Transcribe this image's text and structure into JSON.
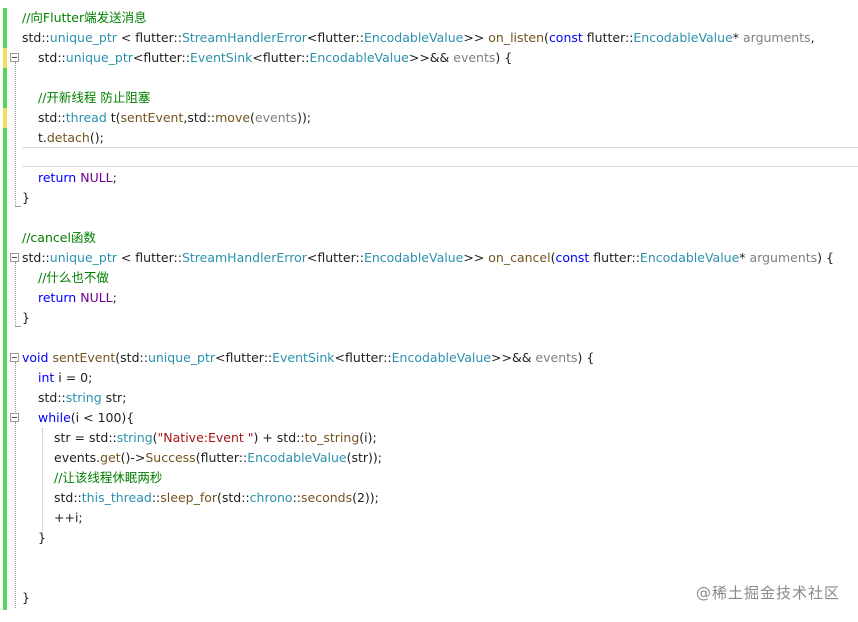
{
  "colors": {
    "keyword": "#0000ff",
    "type": "#2b91af",
    "function": "#74531f",
    "comment": "#008000",
    "string": "#a31515",
    "macro": "#6f008a",
    "parameter": "#808080",
    "plain": "#1e1e1e",
    "gutter_saved": "#5cd35c",
    "gutter_unsaved": "#f2df5a"
  },
  "watermark": "@稀土掘金技术社区",
  "lines": [
    {
      "indent": 0,
      "tokens": [
        {
          "t": "//向Flutter端发送消息",
          "c": "cm"
        }
      ]
    },
    {
      "indent": 0,
      "tokens": [
        {
          "t": "std::",
          "c": "pl"
        },
        {
          "t": "unique_ptr",
          "c": "ty"
        },
        {
          "t": " < flutter::",
          "c": "pl"
        },
        {
          "t": "StreamHandlerError",
          "c": "ty"
        },
        {
          "t": "<flutter::",
          "c": "pl"
        },
        {
          "t": "EncodableValue",
          "c": "ty"
        },
        {
          "t": ">> ",
          "c": "pl"
        },
        {
          "t": "on_listen",
          "c": "fn"
        },
        {
          "t": "(",
          "c": "pl"
        },
        {
          "t": "const",
          "c": "kw"
        },
        {
          "t": " flutter::",
          "c": "pl"
        },
        {
          "t": "EncodableValue",
          "c": "ty"
        },
        {
          "t": "* ",
          "c": "pl"
        },
        {
          "t": "arguments",
          "c": "par"
        },
        {
          "t": ",",
          "c": "pl"
        }
      ]
    },
    {
      "indent": 1,
      "tokens": [
        {
          "t": "std::",
          "c": "pl"
        },
        {
          "t": "unique_ptr",
          "c": "ty"
        },
        {
          "t": "<flutter::",
          "c": "pl"
        },
        {
          "t": "EventSink",
          "c": "ty"
        },
        {
          "t": "<flutter::",
          "c": "pl"
        },
        {
          "t": "EncodableValue",
          "c": "ty"
        },
        {
          "t": ">>&& ",
          "c": "pl"
        },
        {
          "t": "events",
          "c": "par"
        },
        {
          "t": ") {",
          "c": "pl"
        }
      ]
    },
    {
      "indent": 0,
      "tokens": []
    },
    {
      "indent": 1,
      "tokens": [
        {
          "t": "//开新线程 防止阻塞",
          "c": "cm"
        }
      ]
    },
    {
      "indent": 1,
      "tokens": [
        {
          "t": "std::",
          "c": "pl"
        },
        {
          "t": "thread",
          "c": "ty"
        },
        {
          "t": " t(",
          "c": "pl"
        },
        {
          "t": "sentEvent",
          "c": "fn"
        },
        {
          "t": ",std::",
          "c": "pl"
        },
        {
          "t": "move",
          "c": "fn"
        },
        {
          "t": "(",
          "c": "pl"
        },
        {
          "t": "events",
          "c": "par"
        },
        {
          "t": "));",
          "c": "pl"
        }
      ]
    },
    {
      "indent": 1,
      "tokens": [
        {
          "t": "t.",
          "c": "pl"
        },
        {
          "t": "detach",
          "c": "fn"
        },
        {
          "t": "();",
          "c": "pl"
        }
      ]
    },
    {
      "indent": 0,
      "tokens": []
    },
    {
      "indent": 1,
      "tokens": [
        {
          "t": "return",
          "c": "kw"
        },
        {
          "t": " ",
          "c": "pl"
        },
        {
          "t": "NULL",
          "c": "mac"
        },
        {
          "t": ";",
          "c": "pl"
        }
      ]
    },
    {
      "indent": 0,
      "tokens": [
        {
          "t": "}",
          "c": "pl"
        }
      ]
    },
    {
      "indent": 0,
      "tokens": []
    },
    {
      "indent": 0,
      "tokens": [
        {
          "t": "//cancel函数",
          "c": "cm"
        }
      ]
    },
    {
      "indent": 0,
      "tokens": [
        {
          "t": "std::",
          "c": "pl"
        },
        {
          "t": "unique_ptr",
          "c": "ty"
        },
        {
          "t": " < flutter::",
          "c": "pl"
        },
        {
          "t": "StreamHandlerError",
          "c": "ty"
        },
        {
          "t": "<flutter::",
          "c": "pl"
        },
        {
          "t": "EncodableValue",
          "c": "ty"
        },
        {
          "t": ">> ",
          "c": "pl"
        },
        {
          "t": "on_cancel",
          "c": "fn"
        },
        {
          "t": "(",
          "c": "pl"
        },
        {
          "t": "const",
          "c": "kw"
        },
        {
          "t": " flutter::",
          "c": "pl"
        },
        {
          "t": "EncodableValue",
          "c": "ty"
        },
        {
          "t": "* ",
          "c": "pl"
        },
        {
          "t": "arguments",
          "c": "par"
        },
        {
          "t": ") {",
          "c": "pl"
        }
      ]
    },
    {
      "indent": 1,
      "tokens": [
        {
          "t": "//什么也不做",
          "c": "cm"
        }
      ]
    },
    {
      "indent": 1,
      "tokens": [
        {
          "t": "return",
          "c": "kw"
        },
        {
          "t": " ",
          "c": "pl"
        },
        {
          "t": "NULL",
          "c": "mac"
        },
        {
          "t": ";",
          "c": "pl"
        }
      ]
    },
    {
      "indent": 0,
      "tokens": [
        {
          "t": "}",
          "c": "pl"
        }
      ]
    },
    {
      "indent": 0,
      "tokens": []
    },
    {
      "indent": 0,
      "tokens": [
        {
          "t": "void",
          "c": "kw"
        },
        {
          "t": " ",
          "c": "pl"
        },
        {
          "t": "sentEvent",
          "c": "fn"
        },
        {
          "t": "(std::",
          "c": "pl"
        },
        {
          "t": "unique_ptr",
          "c": "ty"
        },
        {
          "t": "<flutter::",
          "c": "pl"
        },
        {
          "t": "EventSink",
          "c": "ty"
        },
        {
          "t": "<flutter::",
          "c": "pl"
        },
        {
          "t": "EncodableValue",
          "c": "ty"
        },
        {
          "t": ">>&& ",
          "c": "pl"
        },
        {
          "t": "events",
          "c": "par"
        },
        {
          "t": ") {",
          "c": "pl"
        }
      ]
    },
    {
      "indent": 1,
      "tokens": [
        {
          "t": "int",
          "c": "kw"
        },
        {
          "t": " i = 0;",
          "c": "pl"
        }
      ]
    },
    {
      "indent": 1,
      "tokens": [
        {
          "t": "std::",
          "c": "pl"
        },
        {
          "t": "string",
          "c": "ty"
        },
        {
          "t": " str;",
          "c": "pl"
        }
      ]
    },
    {
      "indent": 1,
      "tokens": [
        {
          "t": "while",
          "c": "kw"
        },
        {
          "t": "(i < 100){",
          "c": "pl"
        }
      ]
    },
    {
      "indent": 2,
      "tokens": [
        {
          "t": "str = std::",
          "c": "pl"
        },
        {
          "t": "string",
          "c": "ty"
        },
        {
          "t": "(",
          "c": "pl"
        },
        {
          "t": "\"Native:Event \"",
          "c": "st"
        },
        {
          "t": ") + std::",
          "c": "pl"
        },
        {
          "t": "to_string",
          "c": "fn"
        },
        {
          "t": "(i);",
          "c": "pl"
        }
      ]
    },
    {
      "indent": 2,
      "tokens": [
        {
          "t": "events.",
          "c": "pl"
        },
        {
          "t": "get",
          "c": "fn"
        },
        {
          "t": "()->",
          "c": "pl"
        },
        {
          "t": "Success",
          "c": "fn"
        },
        {
          "t": "(flutter::",
          "c": "pl"
        },
        {
          "t": "EncodableValue",
          "c": "ty"
        },
        {
          "t": "(str));",
          "c": "pl"
        }
      ]
    },
    {
      "indent": 2,
      "tokens": [
        {
          "t": "//让该线程休眠两秒",
          "c": "cm"
        }
      ]
    },
    {
      "indent": 2,
      "tokens": [
        {
          "t": "std::",
          "c": "pl"
        },
        {
          "t": "this_thread",
          "c": "ty"
        },
        {
          "t": "::",
          "c": "pl"
        },
        {
          "t": "sleep_for",
          "c": "fn"
        },
        {
          "t": "(std::",
          "c": "pl"
        },
        {
          "t": "chrono",
          "c": "ty"
        },
        {
          "t": "::",
          "c": "pl"
        },
        {
          "t": "seconds",
          "c": "fn"
        },
        {
          "t": "(2));",
          "c": "pl"
        }
      ]
    },
    {
      "indent": 2,
      "tokens": [
        {
          "t": "++i;",
          "c": "pl"
        }
      ]
    },
    {
      "indent": 1,
      "tokens": [
        {
          "t": "}",
          "c": "pl"
        }
      ]
    },
    {
      "indent": 0,
      "tokens": []
    },
    {
      "indent": 0,
      "tokens": []
    },
    {
      "indent": 0,
      "tokens": [
        {
          "t": "}",
          "c": "pl"
        }
      ]
    }
  ]
}
